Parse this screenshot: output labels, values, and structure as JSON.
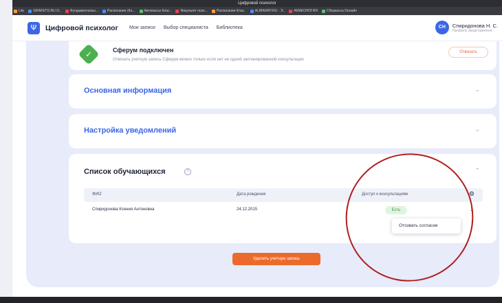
{
  "window": {
    "title": "Цифровой психолог"
  },
  "bookmarks": [
    "Lite",
    "GRAFETO.RU O..",
    "Фундаментальн...",
    "Расписание (Ко...",
    "Автокассы Клас..",
    "Факультет псих...",
    "Расписание Клас..",
    "ALIBRARY.RU - Э..",
    "АКМЕОЛОГИЯ",
    "Сберкасса Онлайн"
  ],
  "header": {
    "brand": "Цифровой психолог",
    "nav": [
      "Мои записи",
      "Выбор специалиста",
      "Библиотека"
    ],
    "user_initials": "СН",
    "user_name": "Спиридонова Н. С.",
    "user_role": "Профиль представителя"
  },
  "sferum": {
    "title": "Сферум подключен",
    "description": "Отвязать учетную запись Сферум можно только если нет ни одной запланированной консультации",
    "unlink_label": "Отвязать"
  },
  "sections": {
    "main_info": "Основная информация",
    "notifications": "Настройка уведомлений"
  },
  "students": {
    "title": "Список обучающихся",
    "help": "?",
    "columns": [
      "ФИО",
      "Дата рождения",
      "Доступ к консультациям"
    ],
    "rows": [
      {
        "name": "Спиридонова Ксения Антоновна",
        "birth": "24.12.2015",
        "access": "Есть"
      }
    ],
    "menu_revoke": "Отозвать согласие"
  },
  "delete_label": "Удалить учетную запись",
  "icons": {
    "logo": "psi-logo-icon",
    "check": "check-badge-icon",
    "gear": "gear-icon",
    "kebab": "kebab-menu-icon",
    "chevron": "chevron-icon"
  },
  "colors": {
    "accent": "#3b66e6",
    "danger": "#ec6a2c",
    "success": "#4caf50",
    "annotation": "#b01f1f"
  }
}
